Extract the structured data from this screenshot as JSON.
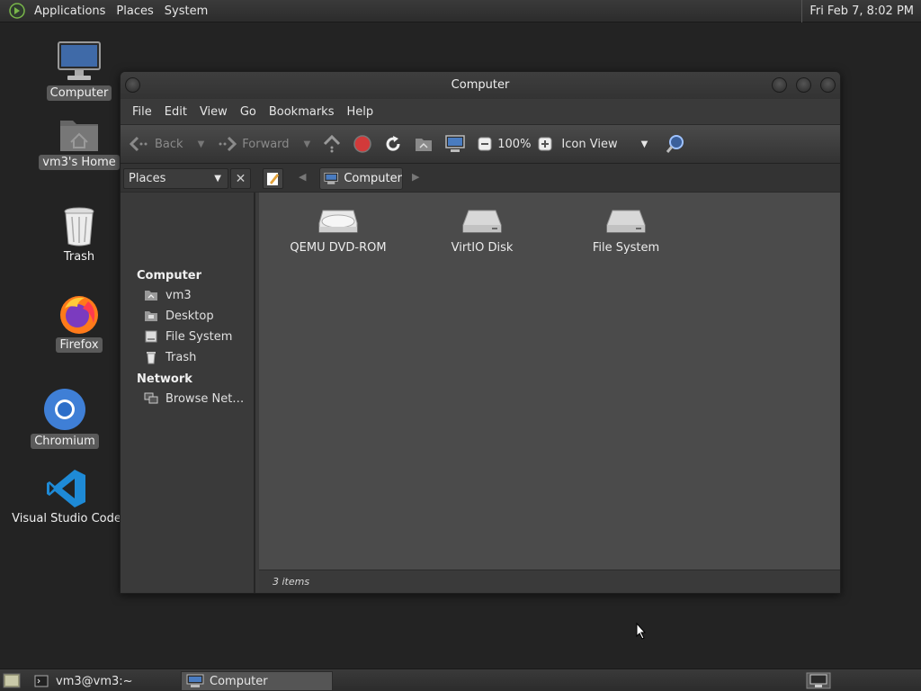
{
  "top_panel": {
    "menus": [
      "Applications",
      "Places",
      "System"
    ],
    "clock": "Fri Feb  7,  8:02 PM"
  },
  "desktop": {
    "icons": [
      {
        "label": "Computer",
        "icon": "computer-icon",
        "selected": true
      },
      {
        "label": "vm3's Home",
        "icon": "home-folder-icon",
        "selected": true
      },
      {
        "label": "Trash",
        "icon": "trash-icon",
        "selected": false
      },
      {
        "label": "Firefox",
        "icon": "firefox-icon",
        "selected": true
      },
      {
        "label": "Chromium",
        "icon": "chromium-icon",
        "selected": true
      },
      {
        "label": "Visual Studio Code",
        "icon": "vscode-icon",
        "selected": false
      }
    ]
  },
  "window": {
    "title": "Computer",
    "menu": [
      "File",
      "Edit",
      "View",
      "Go",
      "Bookmarks",
      "Help"
    ],
    "toolbar": {
      "back": "Back",
      "forward": "Forward",
      "zoom": "100%",
      "view_mode": "Icon View"
    },
    "sidebar_select": "Places",
    "breadcrumb": "Computer",
    "sidebar": {
      "sections": [
        {
          "heading": "Computer",
          "items": [
            {
              "label": "vm3",
              "icon": "home-icon"
            },
            {
              "label": "Desktop",
              "icon": "desktop-icon"
            },
            {
              "label": "File System",
              "icon": "filesystem-icon"
            },
            {
              "label": "Trash",
              "icon": "trash-icon"
            }
          ]
        },
        {
          "heading": "Network",
          "items": [
            {
              "label": "Browse Net…",
              "icon": "network-icon"
            }
          ]
        }
      ]
    },
    "files": [
      {
        "label": "QEMU DVD-ROM",
        "icon": "optical-drive-icon"
      },
      {
        "label": "VirtIO Disk",
        "icon": "hard-disk-icon"
      },
      {
        "label": "File System",
        "icon": "hard-disk-icon"
      }
    ],
    "status": "3 items"
  },
  "taskbar": {
    "tasks": [
      {
        "label": "vm3@vm3:~",
        "active": false
      },
      {
        "label": "Computer",
        "active": true
      }
    ]
  }
}
